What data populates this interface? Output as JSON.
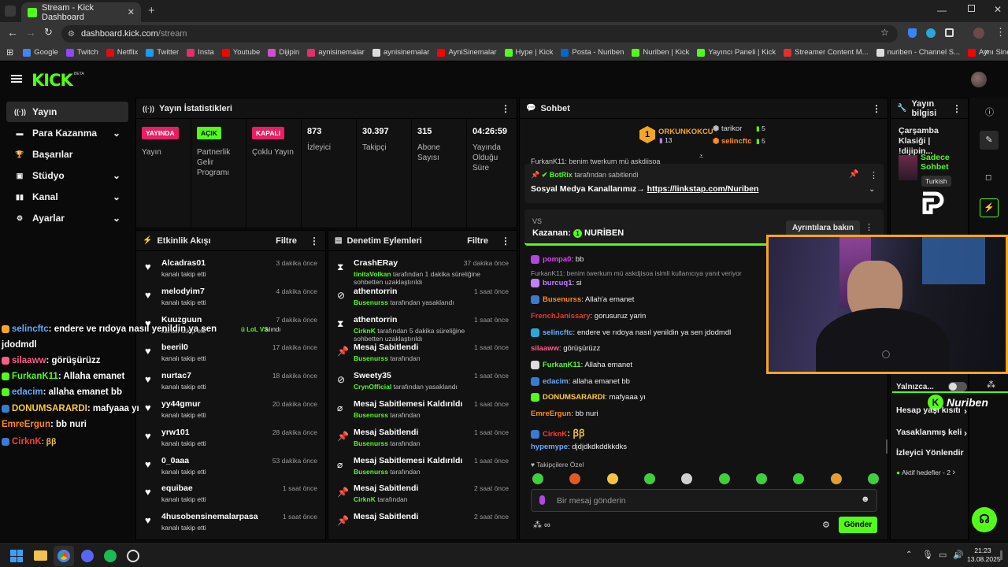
{
  "browser": {
    "tab_title": "Stream - Kick Dashboard",
    "url_host": "dashboard.kick.com",
    "url_path": "/stream",
    "bookmarks": [
      {
        "label": "Google",
        "color": "#4285f4"
      },
      {
        "label": "Twitch",
        "color": "#9146ff"
      },
      {
        "label": "Netflix",
        "color": "#e50914"
      },
      {
        "label": "Twitter",
        "color": "#1d9bf0"
      },
      {
        "label": "Insta",
        "color": "#e1306c"
      },
      {
        "label": "Youtube",
        "color": "#ff0000"
      },
      {
        "label": "Dijipin",
        "color": "#d04fd0"
      },
      {
        "label": "aynisinemalar",
        "color": "#e1306c"
      },
      {
        "label": "aynisinemalar",
        "color": "#dddddd"
      },
      {
        "label": "AyniSinemalar",
        "color": "#ff0000"
      },
      {
        "label": "Hype | Kick",
        "color": "#53fc18"
      },
      {
        "label": "Posta - Nuriben",
        "color": "#0a66c2"
      },
      {
        "label": "Nuriben | Kick",
        "color": "#53fc18"
      },
      {
        "label": "Yayıncı Paneli | Kick",
        "color": "#53fc18"
      },
      {
        "label": "Streamer Content M...",
        "color": "#e03030"
      },
      {
        "label": "nuriben - Channel S...",
        "color": "#dddddd"
      },
      {
        "label": "Aynı Sinemalar - Ça...",
        "color": "#ff0000"
      }
    ]
  },
  "brand": {
    "logo": "KICK",
    "beta": "BETA",
    "accent": "#53fc18"
  },
  "sidebar": {
    "items": [
      {
        "label": "Yayın",
        "icon": "broadcast-icon",
        "chev": false
      },
      {
        "label": "Para Kazanma",
        "icon": "money-icon",
        "chev": true
      },
      {
        "label": "Başarılar",
        "icon": "trophy-icon",
        "chev": false
      },
      {
        "label": "Stüdyo",
        "icon": "studio-icon",
        "chev": true
      },
      {
        "label": "Kanal",
        "icon": "channel-icon",
        "chev": true
      },
      {
        "label": "Ayarlar",
        "icon": "gear-icon",
        "chev": true
      }
    ]
  },
  "stats": {
    "title": "Yayın İstatistikleri",
    "cells": [
      {
        "badge": "YAYINDA",
        "badge_color": "#e91e63",
        "label": "Yayın"
      },
      {
        "badge": "AÇIK",
        "badge_color": "#53fc18",
        "label": "Partnerlik Gelir Programı"
      },
      {
        "badge": "KAPALI",
        "badge_color": "#e91e63",
        "label": "Çoklu Yayın"
      },
      {
        "value": "873",
        "label": "İzleyici"
      },
      {
        "value": "30.397",
        "label": "Takipçi"
      },
      {
        "value": "315",
        "label": "Abone Sayısı"
      },
      {
        "value": "04:26:59",
        "label": "Yayında Olduğu Süre"
      }
    ]
  },
  "activity": {
    "title": "Etkinlik Akışı",
    "filter": "Filtre",
    "items": [
      {
        "name": "Alcadras01",
        "sub": "kanalı takip etti",
        "time": "3 dakika önce"
      },
      {
        "name": "melodyim7",
        "sub": "kanalı takip etti",
        "time": "4 dakika önce"
      },
      {
        "name": "Kuuzguun",
        "sub": "kanalı takip etti",
        "time": "7 dakika önce"
      },
      {
        "name": "beeril0",
        "sub": "kanalı takip etti",
        "time": "17 dakika önce"
      },
      {
        "name": "nurtac7",
        "sub": "kanalı takip etti",
        "time": "18 dakika önce"
      },
      {
        "name": "yy44gmur",
        "sub": "kanalı takip etti",
        "time": "20 dakika önce"
      },
      {
        "name": "yrw101",
        "sub": "kanalı takip etti",
        "time": "28 dakika önce"
      },
      {
        "name": "0_0aaa",
        "sub": "kanalı takip etti",
        "time": "53 dakika önce"
      },
      {
        "name": "equibae",
        "sub": "kanalı takip etti",
        "time": "1 saat önce"
      },
      {
        "name": "4husobensinemalarpasa",
        "sub": "kanalı takip etti",
        "time": "1 saat önce"
      }
    ]
  },
  "moderation": {
    "title": "Denetim Eylemleri",
    "filter": "Filtre",
    "items": [
      {
        "name": "CrashERay",
        "actor": "tinitaVolkan",
        "sub": " tarafından 1 dakika süreliğine sohbetten uzaklaştırıldı",
        "time": "37 dakika önce",
        "icon": "hourglass-icon"
      },
      {
        "name": "athentorrin",
        "actor": "Busenurss",
        "sub": " tarafından yasaklandı",
        "time": "1 saat önce",
        "icon": "ban-icon"
      },
      {
        "name": "athentorrin",
        "actor": "CirknK",
        "sub": " tarafından 5 dakika süreliğine sohbetten uzaklaştırıldı",
        "time": "1 saat önce",
        "icon": "hourglass-icon"
      },
      {
        "name": "Mesaj Sabitlendi",
        "actor": "Busenurss",
        "sub": " tarafından",
        "time": "1 saat önce",
        "icon": "pin-icon"
      },
      {
        "name": "Sweety35",
        "actor": "CrynOfficial",
        "sub": " tarafından yasaklandı",
        "time": "1 saat önce",
        "icon": "ban-icon"
      },
      {
        "name": "Mesaj Sabitlemesi Kaldırıldı",
        "actor": "Busenurss",
        "sub": " tarafından",
        "time": "1 saat önce",
        "icon": "unpin-icon"
      },
      {
        "name": "Mesaj Sabitlendi",
        "actor": "Busenurss",
        "sub": " tarafından",
        "time": "1 saat önce",
        "icon": "pin-icon"
      },
      {
        "name": "Mesaj Sabitlemesi Kaldırıldı",
        "actor": "Busenurss",
        "sub": " tarafından",
        "time": "1 saat önce",
        "icon": "unpin-icon"
      },
      {
        "name": "Mesaj Sabitlendi",
        "actor": "CirknK",
        "sub": " tarafından",
        "time": "2 saat önce",
        "icon": "pin-icon"
      },
      {
        "name": "Mesaj Sabitlendi",
        "actor": "",
        "sub": "",
        "time": "2 saat önce",
        "icon": "pin-icon"
      }
    ]
  },
  "chat": {
    "title": "Sohbet",
    "leaders": {
      "first": {
        "name": "ORKUNKOKCU",
        "rank": "1",
        "count": "13"
      },
      "second": {
        "name": "tarikor",
        "count": "5"
      },
      "third": {
        "name": "selincftc",
        "count": "5"
      }
    },
    "clipped_line": "FurkanK11: benim twerkum mü askdjisoa",
    "pinned": {
      "by": "BotRix",
      "by_suffix": "tarafından sabitlendi",
      "text": "Sosyal Medya Kanallarımız→ ",
      "link": "https://linkstap.com/Nuriben"
    },
    "prediction": {
      "vs": "VS",
      "label": "Kazanan:",
      "rank": "1",
      "winner": "NURİBEN",
      "button": "Ayrıntılara bakın"
    },
    "messages": [
      {
        "user": "pompa0",
        "color": "#e040fb",
        "text": ": bb"
      },
      {
        "reply": "FurkanK11: benim twerkum mü askdjisoa isimli kullanıcıya yanıt veriyor"
      },
      {
        "user": "burcuq1",
        "color": "#c080ff",
        "text": ": si"
      },
      {
        "user": "Busenurss",
        "color": "#ff8c1a",
        "text": ": Allah'a emanet"
      },
      {
        "user": "FrenchJanissary",
        "color": "#e53935",
        "text": ": gorusuruz yarin"
      },
      {
        "user": "selincftc",
        "color": "#5fb0ff",
        "text": ": endere ve rıdoya nasıl yenildin ya sen jdodmdl"
      },
      {
        "user": "silaaww",
        "color": "#ff5c8a",
        "text": ": görüşürüzz"
      },
      {
        "user": "FurkanK11",
        "color": "#53fc18",
        "text": ": Allaha emanet"
      },
      {
        "user": "edacim",
        "color": "#6fa8ff",
        "text": ": allaha emanet bb"
      },
      {
        "user": "DONUMSARARDI",
        "color": "#ffcc33",
        "text": ": mafyaaa yı"
      },
      {
        "user": "EmreErgun",
        "color": "#ff8c1a",
        "text": ": bb nuri"
      },
      {
        "user": "CirknK",
        "color": "#ff3b3b",
        "text": ": ꞵꞵ"
      },
      {
        "user": "hypemype",
        "color": "#6fa8ff",
        "text": ": djdjdkdkddkkdks"
      }
    ],
    "emote_label": "Takipçilere Özel",
    "input_placeholder": "Bir mesaj gönderin",
    "send": "Gönder"
  },
  "overlay_chat": [
    {
      "user": "selincftc",
      "color": "#5fb0ff",
      "text": ": endere ve rıdoya nasıl yenildin ya sen"
    },
    {
      "user": "",
      "color": "#ffffff",
      "text": "jdodmdl"
    },
    {
      "user": "silaaww",
      "color": "#ff5c8a",
      "text": ": görüşürüzz"
    },
    {
      "user": "FurkanK11",
      "color": "#53fc18",
      "text": ": Allaha emanet"
    },
    {
      "user": "edacim",
      "color": "#5fb0ff",
      "text": ": allaha emanet bb"
    },
    {
      "user": "DONUMSARARDI",
      "color": "#ffcc33",
      "text": ": mafyaaa yı"
    },
    {
      "user": "EmreErgun",
      "color": "#ff8c1a",
      "text": ": bb nuri"
    },
    {
      "user": "CirknK",
      "color": "#ff3b3b",
      "text": ": ꞵꞵ"
    }
  ],
  "overlay_fragment": "ü LoL VS",
  "overlay_fragment2": "alındı",
  "stream_info": {
    "title": "Yayın bilgisi",
    "stream_title": "Çarşamba Klasiği | !dijipin...",
    "category": "Sadece Sohbet",
    "language": "Turkish"
  },
  "right_panel": {
    "only_label": "Yalnızca...",
    "items": [
      "Hesap yaşı kısıtı",
      "Yasaklanmış keli",
      "İzleyici Yönlendir"
    ],
    "active_goals": "Aktif hedefler - 2",
    "watermark": "Nuriben"
  },
  "taskbar": {
    "time": "21:23",
    "date": "13.08.2025"
  }
}
